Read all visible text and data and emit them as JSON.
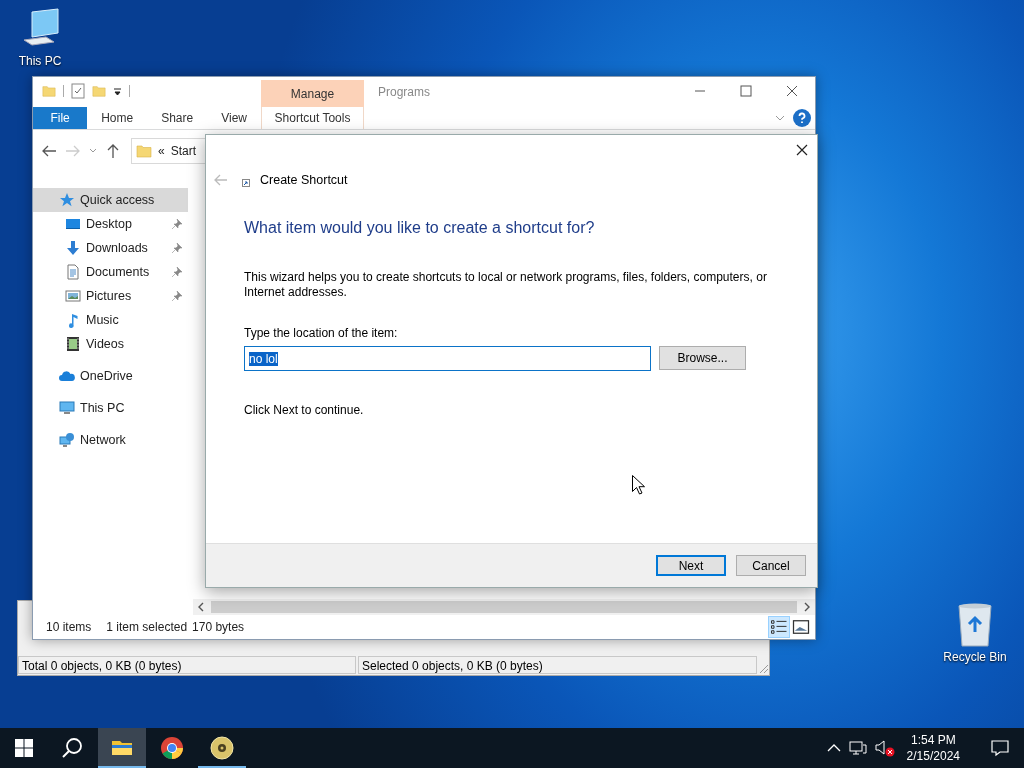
{
  "desktop_icons": [
    {
      "label": "This PC",
      "kind": "pc"
    },
    {
      "label": "Recycle Bin",
      "kind": "bin"
    }
  ],
  "background_window": {
    "status_panes": [
      "Total 0 objects, 0 KB (0 bytes)",
      "Selected 0 objects, 0 KB (0 bytes)"
    ]
  },
  "explorer": {
    "title": "Programs",
    "context_tab": "Manage",
    "ribbon_tabs": [
      {
        "label": "File",
        "kind": "file"
      },
      {
        "label": "Home",
        "kind": "plain"
      },
      {
        "label": "Share",
        "kind": "plain"
      },
      {
        "label": "View",
        "kind": "plain"
      },
      {
        "label": "Shortcut Tools",
        "kind": "context"
      }
    ],
    "address": {
      "overflow": "«",
      "crumb": "Start"
    },
    "sidebar": [
      {
        "label": "Quick access",
        "kind": "star",
        "selected": true,
        "children": [
          {
            "label": "Desktop",
            "kind": "desktop",
            "selected": false,
            "pinned": true
          },
          {
            "label": "Downloads",
            "kind": "downloads",
            "selected": false,
            "pinned": true
          },
          {
            "label": "Documents",
            "kind": "documents",
            "selected": false,
            "pinned": true
          },
          {
            "label": "Pictures",
            "kind": "pictures",
            "selected": false,
            "pinned": true
          },
          {
            "label": "Music",
            "kind": "music",
            "selected": false,
            "pinned": false
          },
          {
            "label": "Videos",
            "kind": "videos",
            "selected": false,
            "pinned": false
          }
        ]
      },
      {
        "label": "OneDrive",
        "kind": "cloud",
        "selected": false
      },
      {
        "label": "This PC",
        "kind": "pc",
        "selected": false
      },
      {
        "label": "Network",
        "kind": "network",
        "selected": false
      }
    ],
    "status": {
      "count": "10 items",
      "selection": "1 item selected",
      "size": "170 bytes"
    },
    "views": [
      {
        "kind": "details",
        "selected": true
      },
      {
        "kind": "tiles",
        "selected": false
      }
    ]
  },
  "dialog": {
    "title": "Create Shortcut",
    "heading": "What item would you like to create a shortcut for?",
    "description": "This wizard helps you to create shortcuts to local or network programs, files, folders, computers, or Internet addresses.",
    "field_label": "Type the location of the item:",
    "field_value": "no lol",
    "value_selected": true,
    "browse": "Browse...",
    "hint": "Click Next to continue.",
    "buttons": [
      {
        "label": "Next",
        "default": true
      },
      {
        "label": "Cancel",
        "default": false
      }
    ]
  },
  "taskbar": {
    "apps": [
      {
        "kind": "explorer",
        "active": true,
        "running": true
      },
      {
        "kind": "chrome",
        "active": false,
        "running": false
      },
      {
        "kind": "disc",
        "active": false,
        "running": true
      }
    ],
    "volume_muted": true,
    "time": "1:54 PM",
    "date": "2/15/2024"
  }
}
